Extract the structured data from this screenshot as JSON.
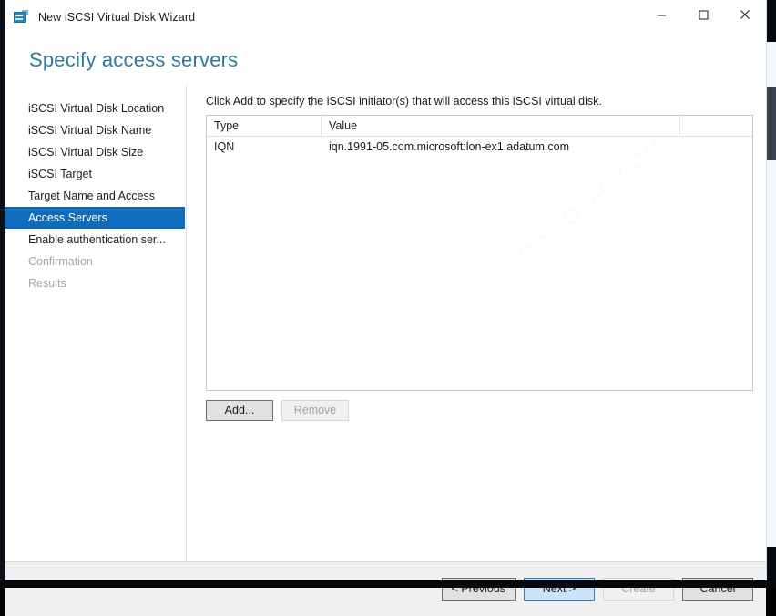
{
  "window": {
    "title": "New iSCSI Virtual Disk Wizard",
    "icon": "iscsi-disk-icon",
    "controls": {
      "minimize": "minimize-icon",
      "maximize": "maximize-icon",
      "close": "close-icon"
    }
  },
  "header": {
    "title": "Specify access servers",
    "accent_color": "#2f7b9e"
  },
  "sidebar": {
    "selected_color": "#0f6cbd",
    "items": [
      {
        "label": "iSCSI Virtual Disk Location",
        "state": "normal"
      },
      {
        "label": "iSCSI Virtual Disk Name",
        "state": "normal"
      },
      {
        "label": "iSCSI Virtual Disk Size",
        "state": "normal"
      },
      {
        "label": "iSCSI Target",
        "state": "normal"
      },
      {
        "label": "Target Name and Access",
        "state": "normal"
      },
      {
        "label": "Access Servers",
        "state": "selected"
      },
      {
        "label": "Enable authentication ser...",
        "state": "normal"
      },
      {
        "label": "Confirmation",
        "state": "disabled"
      },
      {
        "label": "Results",
        "state": "disabled"
      }
    ]
  },
  "main": {
    "instruction": "Click Add to specify the iSCSI initiator(s) that will access this iSCSI virtual disk.",
    "list": {
      "columns": [
        "Type",
        "Value"
      ],
      "rows": [
        {
          "type": "IQN",
          "value": "iqn.1991-05.com.microsoft:lon-ex1.adatum.com"
        }
      ]
    },
    "watermark": "VNSEOLAB.COM",
    "actions": [
      {
        "label": "Add...",
        "state": "enabled"
      },
      {
        "label": "Remove",
        "state": "disabled"
      }
    ]
  },
  "footer": {
    "buttons": [
      {
        "label": "< Previous",
        "state": "enabled"
      },
      {
        "label": "Next >",
        "state": "default"
      },
      {
        "label": "Create",
        "state": "disabled"
      },
      {
        "label": "Cancel",
        "state": "enabled"
      }
    ]
  }
}
